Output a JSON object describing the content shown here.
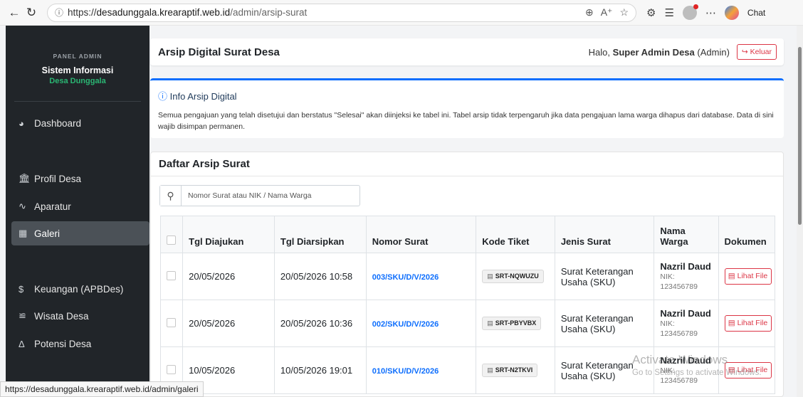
{
  "browser": {
    "url_prefix": "https://",
    "url_host": "desadunggala.krearaptif.web.id",
    "url_path": "/admin/arsip-surat",
    "chat_label": "Chat",
    "status_url": "https://desadunggala.krearaptif.web.id/admin/galeri"
  },
  "sidebar": {
    "panel_label": "PANEL ADMIN",
    "system_title": "Sistem Informasi",
    "village": "Desa Dunggala",
    "items": [
      {
        "label": "Dashboard",
        "icon": "dashboard-icon"
      },
      {
        "label": "Profil Desa",
        "icon": "building-icon"
      },
      {
        "label": "Aparatur",
        "icon": "users-icon"
      },
      {
        "label": "Galeri",
        "icon": "image-icon",
        "active": true
      },
      {
        "label": "Keuangan (APBDes)",
        "icon": "dollar-icon"
      },
      {
        "label": "Wisata Desa",
        "icon": "landscape-icon"
      },
      {
        "label": "Potensi Desa",
        "icon": "potential-icon"
      }
    ]
  },
  "header": {
    "title": "Arsip Digital Surat Desa",
    "greeting": "Halo,",
    "user_name": "Super Admin Desa",
    "role": "(Admin)",
    "logout_label": "Keluar"
  },
  "info": {
    "title": "Info Arsip Digital",
    "text": "Semua pengajuan yang telah disetujui dan berstatus \"Selesai\" akan diinjeksi ke tabel ini. Tabel arsip tidak terpengaruh jika data pengajuan lama warga dihapus dari database. Data di sini wajib disimpan permanen."
  },
  "archive": {
    "title": "Daftar Arsip Surat",
    "search_placeholder": "Nomor Surat atau NIK / Nama Warga",
    "columns": [
      "Tgl Diajukan",
      "Tgl Diarsipkan",
      "Nomor Surat",
      "Kode Tiket",
      "Jenis Surat",
      "Nama Warga",
      "Dokumen"
    ],
    "rows": [
      {
        "tgl_diajukan": "20/05/2026",
        "tgl_diarsipkan": "20/05/2026 10:58",
        "nomor": "003/SKU/D/V/2026",
        "tiket": "SRT-NQWUZU",
        "jenis": "Surat Keterangan Usaha (SKU)",
        "nama": "Nazril Daud",
        "nik_label": "NIK:",
        "nik": "123456789",
        "doc": "Lihat File"
      },
      {
        "tgl_diajukan": "20/05/2026",
        "tgl_diarsipkan": "20/05/2026 10:36",
        "nomor": "002/SKU/D/V/2026",
        "tiket": "SRT-PBYVBX",
        "jenis": "Surat Keterangan Usaha (SKU)",
        "nama": "Nazril Daud",
        "nik_label": "NIK:",
        "nik": "123456789",
        "doc": "Lihat File"
      },
      {
        "tgl_diajukan": "10/05/2026",
        "tgl_diarsipkan": "10/05/2026 19:01",
        "nomor": "010/SKU/D/V/2026",
        "tiket": "SRT-N2TKVI",
        "jenis": "Surat Keterangan Usaha (SKU)",
        "nama": "Nazril Daud",
        "nik_label": "NIK:",
        "nik": "123456789",
        "doc": "Lihat File"
      }
    ]
  },
  "watermark": {
    "line1": "Activate Windows",
    "line2": "Go to Settings to activate Windows."
  }
}
